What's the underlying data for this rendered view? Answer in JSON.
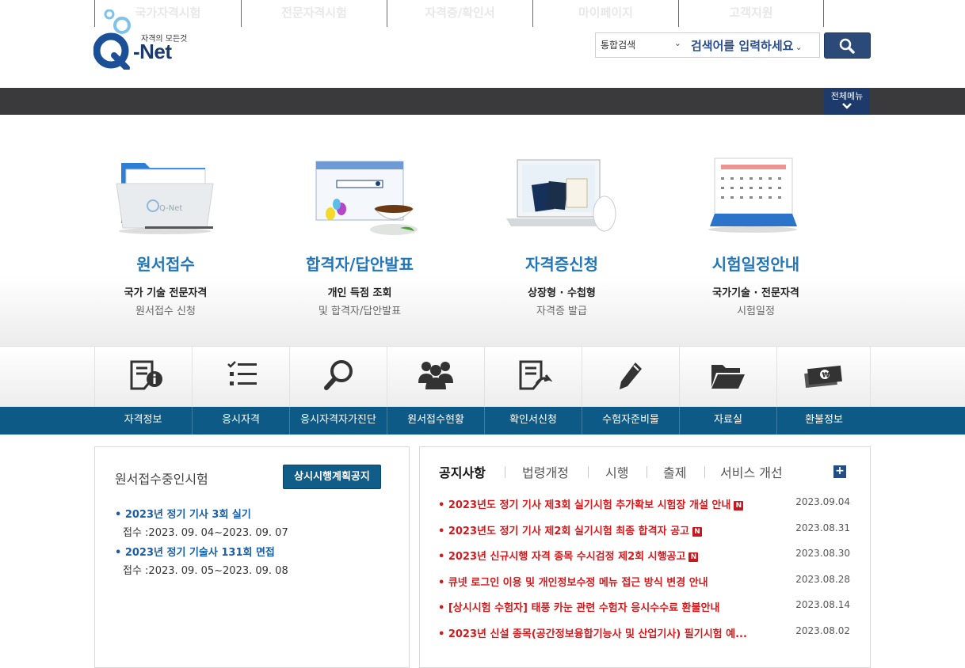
{
  "logo": {
    "tagline": "자격의 모든것",
    "name": "Q-Net"
  },
  "search": {
    "scope": "통합검색",
    "placeholder": "검색어를 입력하세요"
  },
  "gnb": {
    "items": [
      "국가자격시험",
      "전문자격시험",
      "자격증/확인서",
      "마이페이지",
      "고객지원"
    ],
    "all_menu": "전체메뉴"
  },
  "hero": [
    {
      "title": "원서접수",
      "sub1": "국가 기술 전문자격",
      "sub2": "원서접수 신청",
      "icon": "folder-icon"
    },
    {
      "title": "합격자/답안발표",
      "sub1": "개인 득점 조회",
      "sub2": "및 합격자/답안발표",
      "icon": "browser-tea-icon"
    },
    {
      "title": "자격증신청",
      "sub1": "상장형 · 수첩형",
      "sub2": "자격증 발급",
      "icon": "certificate-laptop-icon"
    },
    {
      "title": "시험일정안내",
      "sub1": "국가기술 · 전문자격",
      "sub2": "시험일정",
      "icon": "calendar-icon"
    }
  ],
  "quick_menu": [
    {
      "label": "자격정보",
      "icon": "info-document-icon"
    },
    {
      "label": "응시자격",
      "icon": "checklist-icon"
    },
    {
      "label": "응시자격자가진단",
      "icon": "magnifier-icon"
    },
    {
      "label": "원서접수현황",
      "icon": "people-icon"
    },
    {
      "label": "확인서신청",
      "icon": "document-edit-icon"
    },
    {
      "label": "수험자준비물",
      "icon": "pencil-icon"
    },
    {
      "label": "자료실",
      "icon": "folder-open-icon"
    },
    {
      "label": "환불정보",
      "icon": "money-icon"
    }
  ],
  "applications": {
    "title": "원서접수중인시험",
    "button": "상시시행계획공지",
    "items": [
      {
        "name": "• 2023년 정기 기사 3회 실기",
        "date": "접수 :2023. 09. 04~2023. 09. 07"
      },
      {
        "name": "• 2023년 정기 기술사 131회 면접",
        "date": "접수 :2023. 09. 05~2023. 09. 08"
      }
    ]
  },
  "notices": {
    "tabs": [
      "공지사항",
      "법령개정",
      "시행",
      "출제",
      "서비스 개선"
    ],
    "new_badge": "N",
    "items": [
      {
        "title": "• 2023년도 정기 기사 제3회 실기시험 추가확보 시험장 개설 안내",
        "date": "2023.09.04",
        "new": true
      },
      {
        "title": "• 2023년도 정기 기사 제2회 실기시험 최종 합격자 공고",
        "date": "2023.08.31",
        "new": true
      },
      {
        "title": "• 2023년 신규시행 자격 종목 수시검정 제2회 시행공고",
        "date": "2023.08.30",
        "new": true
      },
      {
        "title": "• 큐넷 로그인 이용 및 개인정보수정 메뉴 접근 방식 변경 안내",
        "date": "2023.08.28",
        "new": false
      },
      {
        "title": "• [상시시험 수험자] 태풍 카눈 관련 수험자 응시수수료 환불안내",
        "date": "2023.08.14",
        "new": false
      },
      {
        "title": "• 2023년 신설 종목(공간정보융합기능사 및 산업기사) 필기시험 예...",
        "date": "2023.08.02",
        "new": false
      }
    ]
  },
  "colors": {
    "primary": "#0e5a86",
    "hero_title": "#2276b8",
    "notice_red": "#d7191c",
    "gnb": "#3a3a3c"
  }
}
